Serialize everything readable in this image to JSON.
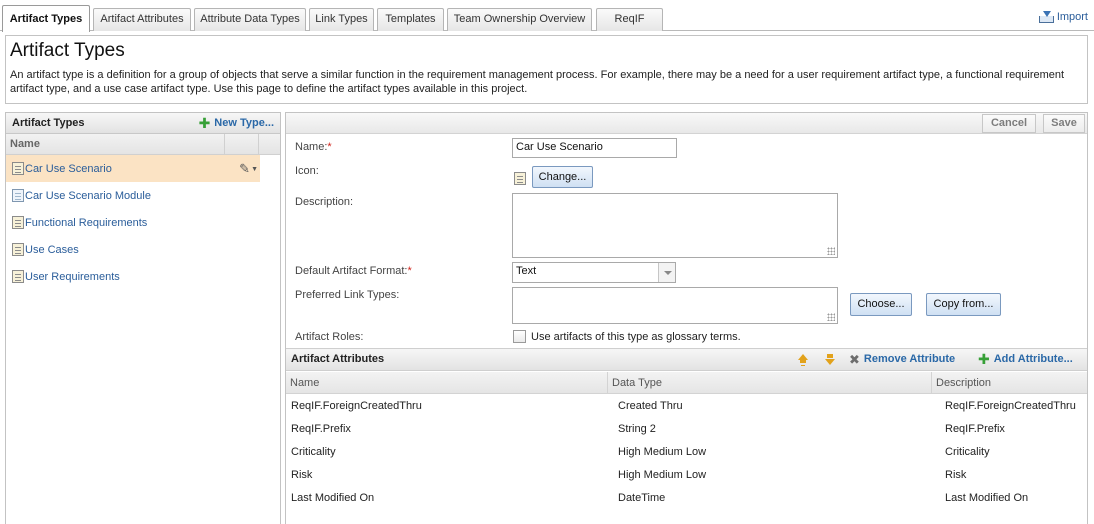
{
  "tabs": [
    {
      "label": "Artifact Types",
      "active": true
    },
    {
      "label": "Artifact Attributes"
    },
    {
      "label": "Attribute Data Types"
    },
    {
      "label": "Link Types"
    },
    {
      "label": "Templates"
    },
    {
      "label": "Team Ownership Overview"
    },
    {
      "label": "ReqIF"
    }
  ],
  "import_label": "Import",
  "header": {
    "title": "Artifact Types",
    "description": "An artifact type is a definition for a group of objects that serve a similar function in the requirement management process. For example, there may be a need for a user requirement artifact type, a functional requirement artifact type, and a use case artifact type. Use this page to define the artifact types available in this project."
  },
  "left_panel": {
    "title": "Artifact Types",
    "new_type_label": "New Type...",
    "column_name": "Name",
    "items": [
      {
        "label": "Car Use Scenario",
        "selected": true
      },
      {
        "label": "Car Use Scenario Module"
      },
      {
        "label": "Functional Requirements"
      },
      {
        "label": "Use Cases"
      },
      {
        "label": "User Requirements"
      }
    ]
  },
  "toolbar": {
    "cancel_label": "Cancel",
    "save_label": "Save"
  },
  "form": {
    "name_label": "Name:",
    "name_value": "Car Use Scenario",
    "icon_label": "Icon:",
    "change_label": "Change...",
    "description_label": "Description:",
    "description_value": "",
    "format_label": "Default Artifact Format:",
    "format_value": "Text",
    "link_types_label": "Preferred Link Types:",
    "choose_label": "Choose...",
    "copy_from_label": "Copy from...",
    "roles_label": "Artifact Roles:",
    "glossary_label": "Use artifacts of this type as glossary terms.",
    "glossary_checked": false,
    "required_marker": "*"
  },
  "attributes": {
    "title": "Artifact Attributes",
    "remove_label": "Remove Attribute",
    "add_label": "Add Attribute...",
    "columns": [
      "Name",
      "Data Type",
      "Description"
    ],
    "rows": [
      {
        "name": "ReqIF.ForeignCreatedThru",
        "type": "Created Thru",
        "description": "ReqIF.ForeignCreatedThru"
      },
      {
        "name": "ReqIF.Prefix",
        "type": "String 2",
        "description": "ReqIF.Prefix"
      },
      {
        "name": "Criticality",
        "type": "High Medium Low",
        "description": "Criticality"
      },
      {
        "name": "Risk",
        "type": "High Medium Low",
        "description": "Risk"
      },
      {
        "name": "Last Modified On",
        "type": "DateTime",
        "description": "Last Modified On"
      }
    ]
  },
  "colors": {
    "link": "#2a68a7",
    "selected_row": "#fbe3c4",
    "required": "#d0231b",
    "add_icon": "#37a037",
    "move_icons": "#e2a21b"
  }
}
